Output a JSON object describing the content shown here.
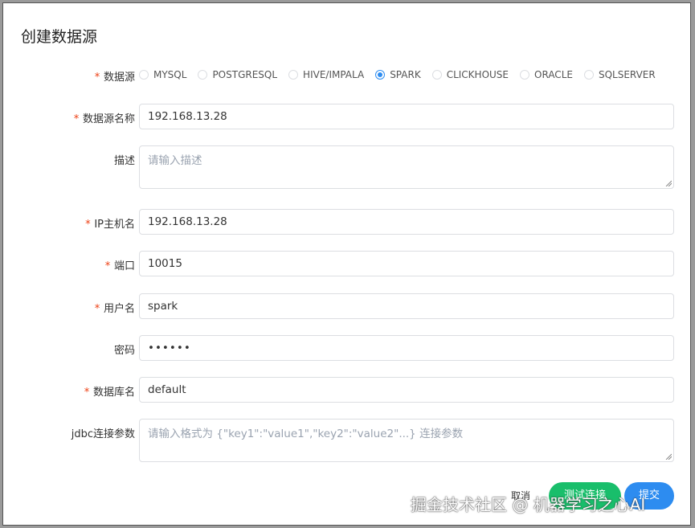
{
  "dialog": {
    "title": "创建数据源"
  },
  "form": {
    "datasource_label": "数据源",
    "datasource_options": [
      "MYSQL",
      "POSTGRESQL",
      "HIVE/IMPALA",
      "SPARK",
      "CLICKHOUSE",
      "ORACLE",
      "SQLSERVER"
    ],
    "datasource_selected": "SPARK",
    "name_label": "数据源名称",
    "name_value": "192.168.13.28",
    "desc_label": "描述",
    "desc_placeholder": "请输入描述",
    "host_label": "IP主机名",
    "host_value": "192.168.13.28",
    "port_label": "端口",
    "port_value": "10015",
    "user_label": "用户名",
    "user_value": "spark",
    "password_label": "密码",
    "password_value": "••••••",
    "db_label": "数据库名",
    "db_value": "default",
    "jdbc_label": "jdbc连接参数",
    "jdbc_placeholder": "请输入格式为 {\"key1\":\"value1\",\"key2\":\"value2\"...} 连接参数",
    "required_mark": "*"
  },
  "footer": {
    "cancel_label": "取消",
    "test_label": "测试连接",
    "submit_label": "提交"
  },
  "watermark": "掘金技术社区 @ 机器学习之心AI",
  "colors": {
    "accent": "#2d8cf0",
    "success": "#19be6b",
    "required": "#ed4014"
  }
}
